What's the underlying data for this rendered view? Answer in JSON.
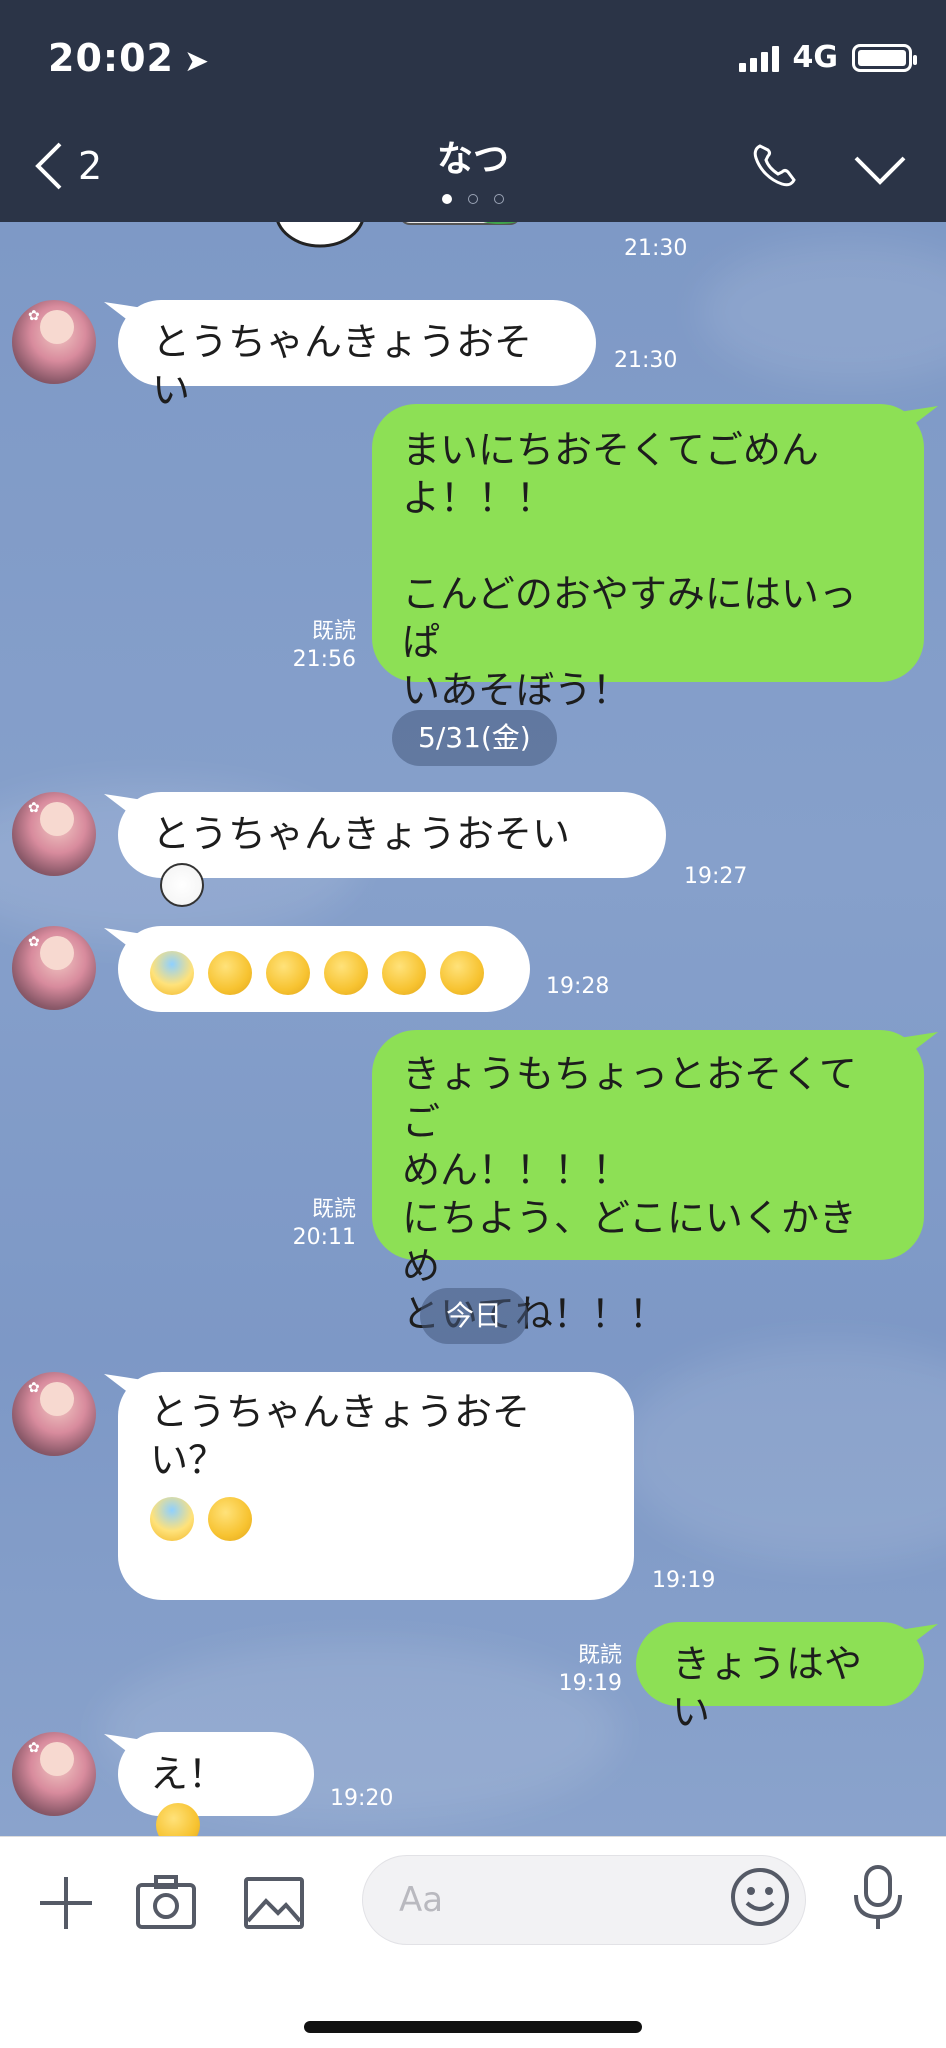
{
  "status": {
    "time": "20:02",
    "network": "4G",
    "battery_level": 1.0
  },
  "header": {
    "back_count": "2",
    "title": "なつ",
    "page_dots": 3,
    "active_dot": 0
  },
  "chat": {
    "top_sticker_time": "21:30",
    "msg1": {
      "text": "とうちゃんきょうおそい",
      "time": "21:30"
    },
    "msg2": {
      "text": "まいにちおそくてごめん\nよ！！！\n\nこんどのおやすみにはいっぱ\nいあそぼう！",
      "read": "既読",
      "time": "21:56"
    },
    "date1": "5/31(金)",
    "msg3": {
      "text": "とうちゃんきょうおそい",
      "emoji": "mask-face-icon",
      "time": "19:27"
    },
    "msg4": {
      "emojis": [
        "fearful-scream-icon",
        "steam-nose-icon",
        "sad-sweat-icon",
        "grin-sweat-icon",
        "yum-icon",
        "grimace-icon"
      ],
      "time": "19:28"
    },
    "msg5": {
      "text": "きょうもちょっとおそくてご\nめん！！！！\nにちよう、どこにいくかきめ\nといてね！！！",
      "read": "既読",
      "time": "20:11"
    },
    "date2": "今日",
    "msg6": {
      "text": "とうちゃんきょうおそい？",
      "emojis": [
        "fearful-scream-icon",
        "halo-smile-icon"
      ],
      "time": "19:19"
    },
    "msg7": {
      "text": "きょうはやい",
      "read": "既読",
      "time": "19:19"
    },
    "msg8": {
      "text": "え！",
      "emoji": "tears-of-joy-icon",
      "time": "19:20"
    }
  },
  "input": {
    "placeholder": "Aa"
  },
  "colors": {
    "header": "#2b3447",
    "chat_bg": "#7b96c4",
    "out_bubble": "#8de055",
    "in_bubble": "#ffffff"
  }
}
